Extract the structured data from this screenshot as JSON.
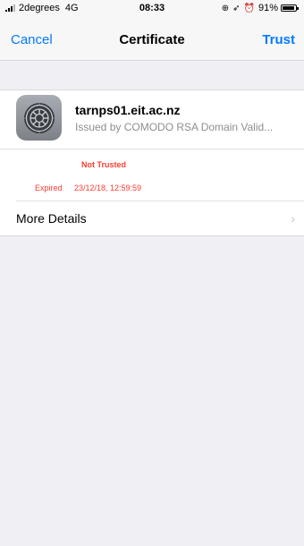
{
  "status_bar": {
    "carrier": "2degrees",
    "network": "4G",
    "time": "08:33",
    "battery_percent": "91%",
    "battery_level": 0.91
  },
  "nav": {
    "cancel_label": "Cancel",
    "title": "Certificate",
    "trust_label": "Trust",
    "accent_color": "#007aff"
  },
  "certificate": {
    "name": "tarnps01.eit.ac.nz",
    "issuer": "Issued by COMODO RSA Domain Valid...",
    "icon": "settings-gear-icon",
    "status": "Not Trusted",
    "expired_label": "Expired",
    "expired_value": "23/12/18, 12:59:59",
    "warning_color": "#ff3b30"
  },
  "details": {
    "more_label": "More Details",
    "chevron": "›"
  }
}
